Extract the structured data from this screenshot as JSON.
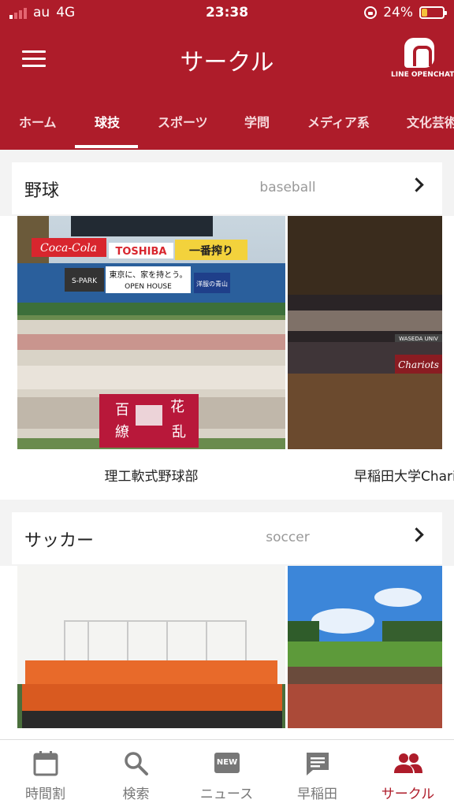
{
  "status": {
    "carrier": "au",
    "network": "4G",
    "time": "23:38",
    "battery": "24%",
    "battery_level": 0.24
  },
  "header": {
    "title": "サークル",
    "openchat_label": "LINE OPENCHAT"
  },
  "tabs": [
    {
      "label": "ホーム"
    },
    {
      "label": "球技",
      "active": true
    },
    {
      "label": "スポーツ"
    },
    {
      "label": "学問"
    },
    {
      "label": "メディア系"
    },
    {
      "label": "文化芸術"
    }
  ],
  "sections": [
    {
      "title": "野球",
      "subtitle": "baseball",
      "cards": [
        {
          "name": "理工軟式野球部",
          "photo_signs": [
            "Coca-Cola",
            "TOSHIBA",
            "一番搾り",
            "S-PARK",
            "東京に、家を持とう。",
            "OPEN HOUSE",
            "洋服の青山"
          ],
          "banner": [
            "百",
            "花",
            "繚",
            "乱"
          ]
        },
        {
          "name": "早稲田大学Chariots",
          "photo_signs": [
            "Chariots",
            "WASEDA UNIV"
          ]
        }
      ]
    },
    {
      "title": "サッカー",
      "subtitle": "soccer",
      "cards": []
    }
  ],
  "bottom_nav": [
    {
      "label": "時間割",
      "icon": "calendar-icon"
    },
    {
      "label": "検索",
      "icon": "search-icon"
    },
    {
      "label": "ニュース",
      "icon": "news-icon",
      "badge": "NEW"
    },
    {
      "label": "早稲田",
      "icon": "chat-icon"
    },
    {
      "label": "サークル",
      "icon": "people-icon",
      "active": true
    }
  ],
  "colors": {
    "brand": "#ae1c2a",
    "background": "#f3f3f3",
    "inactive": "#777777"
  }
}
